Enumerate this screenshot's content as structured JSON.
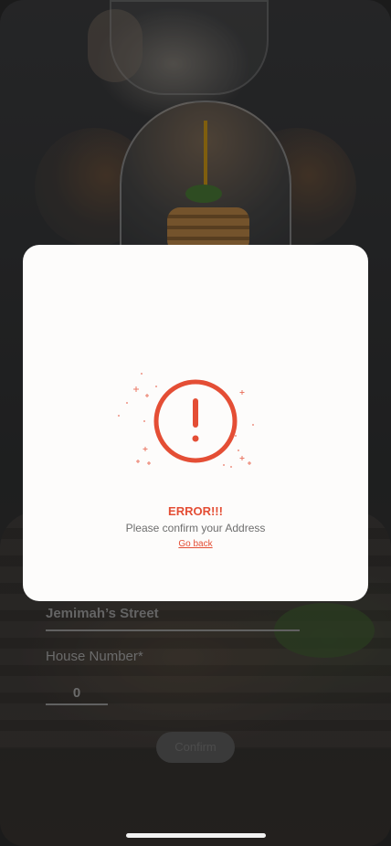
{
  "form": {
    "street_value": "Jemimah’s Street",
    "house_label": "House Number*",
    "house_value": "0",
    "confirm_label": "Confirm"
  },
  "modal": {
    "icon": "exclamation-circle-icon",
    "title": "ERROR!!!",
    "message": "Please confirm your Address",
    "link": "Go back"
  },
  "colors": {
    "accent": "#e44e35",
    "modal_bg": "#fdfcfb",
    "text_muted": "#6e6e6e"
  }
}
